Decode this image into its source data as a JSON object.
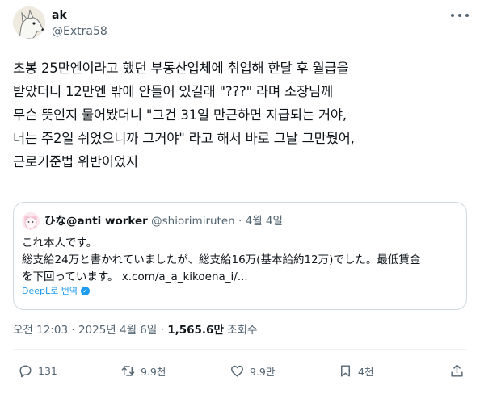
{
  "author": {
    "display_name": "ak",
    "handle": "@Extra58"
  },
  "tweet": {
    "lines": [
      "초봉 25만엔이라고 했던 부동산업체에 취업해 한달 후 월급을",
      "받았더니 12만엔 밖에 안들어 있길래 \"???\" 라며 소장님께",
      "무슨 뜻인지 물어봤더니 \"그건 31일 만근하면 지급되는 거야,",
      "너는 주2일 쉬었으니까 그거야\" 라고 해서 바로 그날 그만뒀어,",
      "근로기준법 위반이었지"
    ]
  },
  "quote": {
    "display_name": "ひな@anti worker",
    "handle": "@shiorimiruten",
    "separator": "·",
    "date": "4월 4일",
    "lines": [
      "これ本人です。",
      "総支給24万と書かれていましたが、総支給16万(基本給約12万)でした。最低賃金",
      "を下回っています。 x.com/a_a_kikoena_i/..."
    ],
    "translate_label": "DeepL로 번역"
  },
  "meta": {
    "time": "오전 12:03",
    "dot1": "·",
    "date": "2025년 4월 6일",
    "dot2": "·",
    "views_count": "1,565.6만",
    "views_label": "조회수"
  },
  "actions": {
    "replies": "131",
    "reposts": "9.9천",
    "likes": "9.9만",
    "bookmarks": "4천"
  },
  "icons": {
    "more": "more-icon",
    "reply": "reply-icon",
    "repost": "repost-icon",
    "like": "heart-icon",
    "bookmark": "bookmark-icon",
    "share": "share-icon",
    "translate": "deepl-icon"
  },
  "colors": {
    "text": "#0f1419",
    "secondary": "#536471",
    "link": "#1d9bf0",
    "border": "#cfd9de"
  }
}
